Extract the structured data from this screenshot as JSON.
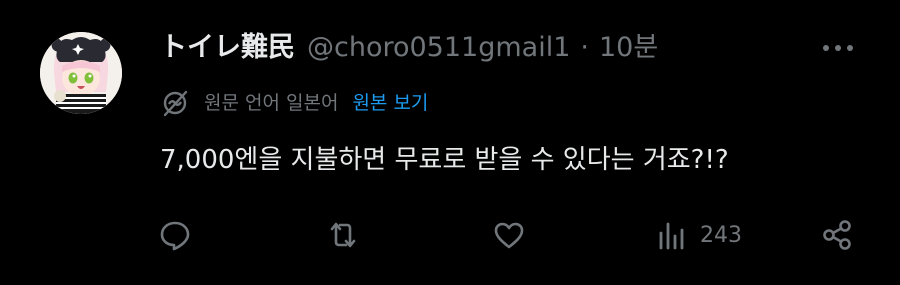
{
  "post": {
    "author": {
      "display_name": "トイレ難民",
      "handle": "@choro0511gmail1",
      "separator": "·",
      "timestamp": "10분"
    },
    "translation": {
      "label": "원문 언어 일본어",
      "link": "원본 보기"
    },
    "text": "7,000엔을 지불하면 무료로 받을 수 있다는 거죠?!?",
    "metrics": {
      "views": "243"
    },
    "icons": {
      "more": "more-dots-icon",
      "translate": "translate-globe-icon",
      "reply": "reply-icon",
      "repost": "repost-icon",
      "like": "heart-icon",
      "views": "views-chart-icon",
      "share": "share-icon"
    },
    "colors": {
      "background": "#000000",
      "primary_text": "#e7e9ea",
      "secondary_text": "#71767b",
      "link": "#1d9bf0"
    }
  }
}
